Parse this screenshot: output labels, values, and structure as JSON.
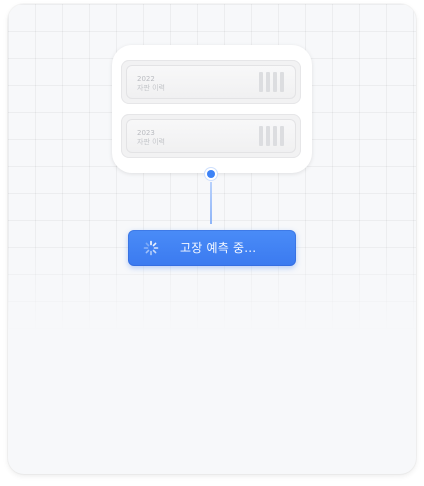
{
  "servers": [
    {
      "year": "2022",
      "name": "자판 이력"
    },
    {
      "year": "2023",
      "name": "자판 이력"
    }
  ],
  "action": {
    "label": "고장 예측 중...",
    "icon": "loading-spinner-icon",
    "status": "loading"
  },
  "colors": {
    "accent": "#3b7af0",
    "background": "#f7f8fa"
  }
}
